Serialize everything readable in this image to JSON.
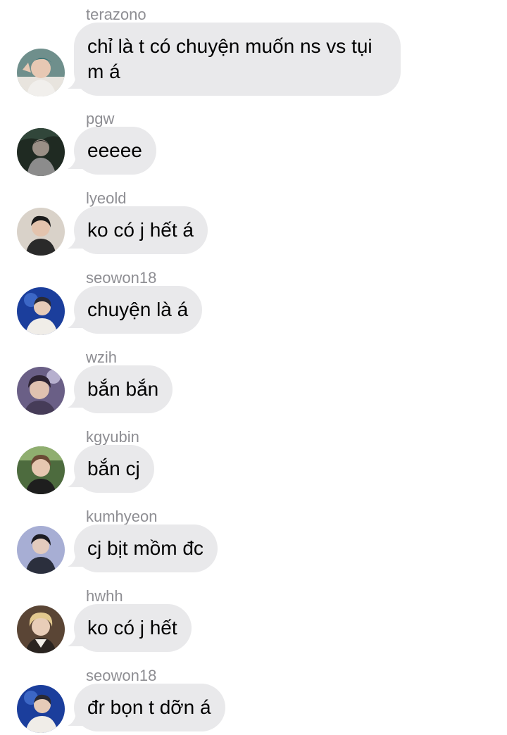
{
  "colors": {
    "bubble": "#e9e9eb",
    "sender_name": "#8e8e93",
    "message_text": "#000000",
    "background": "#ffffff"
  },
  "messages": [
    {
      "sender": "terazono",
      "text": "chỉ là t có chuyện muốn ns vs tụi m á",
      "avatar_icon": "avatar-photo-teal-hair"
    },
    {
      "sender": "pgw",
      "text": "eeeee",
      "avatar_icon": "avatar-photo-dark"
    },
    {
      "sender": "lyeold",
      "text": "ko có j hết á",
      "avatar_icon": "avatar-photo-light"
    },
    {
      "sender": "seowon18",
      "text": "chuyện là á",
      "avatar_icon": "avatar-photo-blue"
    },
    {
      "sender": "wzih",
      "text": "bắn bắn",
      "avatar_icon": "avatar-photo-purple"
    },
    {
      "sender": "kgyubin",
      "text": "bắn cj",
      "avatar_icon": "avatar-photo-green"
    },
    {
      "sender": "kumhyeon",
      "text": "cj bịt mồm đc",
      "avatar_icon": "avatar-photo-lavender"
    },
    {
      "sender": "hwhh",
      "text": "ko có j hết",
      "avatar_icon": "avatar-photo-blond"
    },
    {
      "sender": "seowon18",
      "text": "đr bọn t dỡn á",
      "avatar_icon": "avatar-photo-blue"
    }
  ]
}
